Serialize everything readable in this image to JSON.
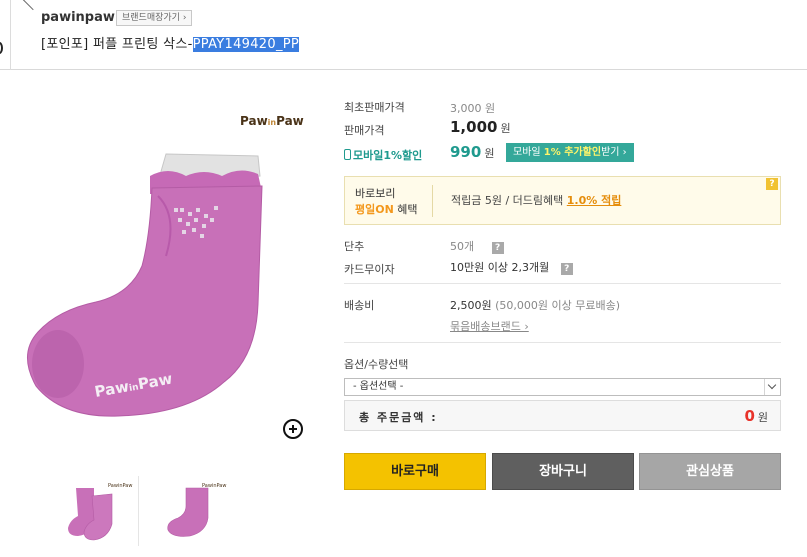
{
  "header": {
    "brand_name": "pawinpaw",
    "brand_store_button": "브랜드매장가기 ›",
    "title_prefix": "[포인포] 퍼플 프린팅 삭스-",
    "title_code_selected": "PPAY149420_PP"
  },
  "product_image": {
    "logo_text": "Paw in Paw",
    "sock_color": "#c870b8"
  },
  "prices": {
    "initial_label": "최초판매가격",
    "initial_value": "3,000 원",
    "sale_label": "판매가격",
    "sale_value": "1,000",
    "currency": "원",
    "mobile_label": "모바일1%할인",
    "mobile_value": "990",
    "mobile_button_prefix": "모바일",
    "mobile_button_highlight": "1% 추가할인",
    "mobile_button_suffix": "받기 ›"
  },
  "benefit": {
    "line1": "바로보리",
    "line2_highlight": "평일ON",
    "line2_suffix": " 혜택",
    "text_prefix": "적립금 5원 / 더드림혜택 ",
    "rate": "1.0% 적립",
    "help_icon": "?"
  },
  "specs": {
    "unit_label": "단추",
    "unit_value": "50개",
    "card_label": "카드무이자",
    "card_value": "10만원 이상 2,3개월",
    "help_icon": "?"
  },
  "shipping": {
    "label": "배송비",
    "value": "2,500원",
    "note": "(50,000원 이상 무료배송)",
    "bundle_link": "묶음배송브랜드 ›"
  },
  "options": {
    "label": "옵션/수량선택",
    "select_value": "- 옵션선택 -"
  },
  "total": {
    "label": "총 주문금액 :",
    "value": "0",
    "unit": "원"
  },
  "buttons": {
    "buy": "바로구매",
    "cart": "장바구니",
    "wish": "관심상품"
  },
  "colors": {
    "accent_teal": "#34a89a",
    "accent_orange": "#f3981d",
    "buy_yellow": "#f4c200",
    "total_red": "#e8332a",
    "selection_blue": "#3a7de0"
  }
}
